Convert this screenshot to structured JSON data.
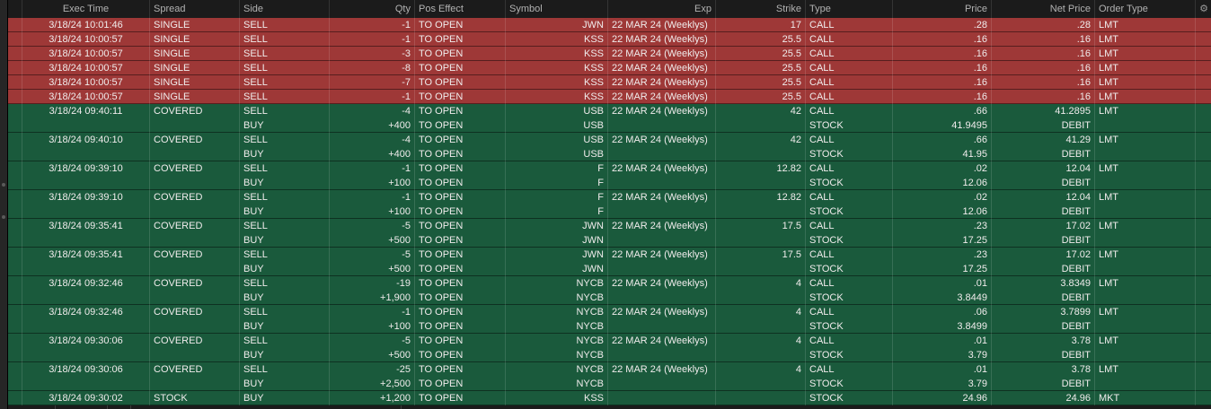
{
  "header": {
    "gear_icon": "⚙",
    "columns": [
      {
        "key": "rowmark",
        "label": ""
      },
      {
        "key": "exec_time",
        "label": "Exec Time"
      },
      {
        "key": "spread",
        "label": "Spread"
      },
      {
        "key": "side",
        "label": "Side"
      },
      {
        "key": "qty",
        "label": "Qty"
      },
      {
        "key": "pos_effect",
        "label": "Pos Effect"
      },
      {
        "key": "symbol",
        "label": "Symbol"
      },
      {
        "key": "exp",
        "label": "Exp"
      },
      {
        "key": "strike",
        "label": "Strike"
      },
      {
        "key": "type",
        "label": "Type"
      },
      {
        "key": "price",
        "label": "Price"
      },
      {
        "key": "net_price",
        "label": "Net Price"
      },
      {
        "key": "order_type",
        "label": "Order Type"
      },
      {
        "key": "gear",
        "label": ""
      }
    ]
  },
  "colors": {
    "sell_row": "#9e3837",
    "buy_covered_row": "#1a5a3c",
    "header_bg": "#1b1b1b"
  },
  "orders": [
    {
      "color": "red",
      "legs": [
        {
          "exec_time": "3/18/24 10:01:46",
          "spread": "SINGLE",
          "side": "SELL",
          "qty": "-1",
          "pos_effect": "TO OPEN",
          "symbol": "JWN",
          "exp": "22 MAR 24 (Weeklys)",
          "strike": "17",
          "type": "CALL",
          "price": ".28",
          "net_price": ".28",
          "order_type": "LMT"
        }
      ]
    },
    {
      "color": "red",
      "legs": [
        {
          "exec_time": "3/18/24 10:00:57",
          "spread": "SINGLE",
          "side": "SELL",
          "qty": "-1",
          "pos_effect": "TO OPEN",
          "symbol": "KSS",
          "exp": "22 MAR 24 (Weeklys)",
          "strike": "25.5",
          "type": "CALL",
          "price": ".16",
          "net_price": ".16",
          "order_type": "LMT"
        }
      ]
    },
    {
      "color": "red",
      "legs": [
        {
          "exec_time": "3/18/24 10:00:57",
          "spread": "SINGLE",
          "side": "SELL",
          "qty": "-3",
          "pos_effect": "TO OPEN",
          "symbol": "KSS",
          "exp": "22 MAR 24 (Weeklys)",
          "strike": "25.5",
          "type": "CALL",
          "price": ".16",
          "net_price": ".16",
          "order_type": "LMT"
        }
      ]
    },
    {
      "color": "red",
      "legs": [
        {
          "exec_time": "3/18/24 10:00:57",
          "spread": "SINGLE",
          "side": "SELL",
          "qty": "-8",
          "pos_effect": "TO OPEN",
          "symbol": "KSS",
          "exp": "22 MAR 24 (Weeklys)",
          "strike": "25.5",
          "type": "CALL",
          "price": ".16",
          "net_price": ".16",
          "order_type": "LMT"
        }
      ]
    },
    {
      "color": "red",
      "legs": [
        {
          "exec_time": "3/18/24 10:00:57",
          "spread": "SINGLE",
          "side": "SELL",
          "qty": "-7",
          "pos_effect": "TO OPEN",
          "symbol": "KSS",
          "exp": "22 MAR 24 (Weeklys)",
          "strike": "25.5",
          "type": "CALL",
          "price": ".16",
          "net_price": ".16",
          "order_type": "LMT"
        }
      ]
    },
    {
      "color": "red",
      "legs": [
        {
          "exec_time": "3/18/24 10:00:57",
          "spread": "SINGLE",
          "side": "SELL",
          "qty": "-1",
          "pos_effect": "TO OPEN",
          "symbol": "KSS",
          "exp": "22 MAR 24 (Weeklys)",
          "strike": "25.5",
          "type": "CALL",
          "price": ".16",
          "net_price": ".16",
          "order_type": "LMT"
        }
      ]
    },
    {
      "color": "green",
      "legs": [
        {
          "exec_time": "3/18/24 09:40:11",
          "spread": "COVERED",
          "side": "SELL",
          "qty": "-4",
          "pos_effect": "TO OPEN",
          "symbol": "USB",
          "exp": "22 MAR 24 (Weeklys)",
          "strike": "42",
          "type": "CALL",
          "price": ".66",
          "net_price": "41.2895",
          "order_type": "LMT"
        },
        {
          "exec_time": "",
          "spread": "",
          "side": "BUY",
          "qty": "+400",
          "pos_effect": "TO OPEN",
          "symbol": "USB",
          "exp": "",
          "strike": "",
          "type": "STOCK",
          "price": "41.9495",
          "net_price": "DEBIT",
          "order_type": ""
        }
      ]
    },
    {
      "color": "green",
      "legs": [
        {
          "exec_time": "3/18/24 09:40:10",
          "spread": "COVERED",
          "side": "SELL",
          "qty": "-4",
          "pos_effect": "TO OPEN",
          "symbol": "USB",
          "exp": "22 MAR 24 (Weeklys)",
          "strike": "42",
          "type": "CALL",
          "price": ".66",
          "net_price": "41.29",
          "order_type": "LMT"
        },
        {
          "exec_time": "",
          "spread": "",
          "side": "BUY",
          "qty": "+400",
          "pos_effect": "TO OPEN",
          "symbol": "USB",
          "exp": "",
          "strike": "",
          "type": "STOCK",
          "price": "41.95",
          "net_price": "DEBIT",
          "order_type": ""
        }
      ]
    },
    {
      "color": "green",
      "legs": [
        {
          "exec_time": "3/18/24 09:39:10",
          "spread": "COVERED",
          "side": "SELL",
          "qty": "-1",
          "pos_effect": "TO OPEN",
          "symbol": "F",
          "exp": "22 MAR 24 (Weeklys)",
          "strike": "12.82",
          "type": "CALL",
          "price": ".02",
          "net_price": "12.04",
          "order_type": "LMT"
        },
        {
          "exec_time": "",
          "spread": "",
          "side": "BUY",
          "qty": "+100",
          "pos_effect": "TO OPEN",
          "symbol": "F",
          "exp": "",
          "strike": "",
          "type": "STOCK",
          "price": "12.06",
          "net_price": "DEBIT",
          "order_type": ""
        }
      ]
    },
    {
      "color": "green",
      "legs": [
        {
          "exec_time": "3/18/24 09:39:10",
          "spread": "COVERED",
          "side": "SELL",
          "qty": "-1",
          "pos_effect": "TO OPEN",
          "symbol": "F",
          "exp": "22 MAR 24 (Weeklys)",
          "strike": "12.82",
          "type": "CALL",
          "price": ".02",
          "net_price": "12.04",
          "order_type": "LMT"
        },
        {
          "exec_time": "",
          "spread": "",
          "side": "BUY",
          "qty": "+100",
          "pos_effect": "TO OPEN",
          "symbol": "F",
          "exp": "",
          "strike": "",
          "type": "STOCK",
          "price": "12.06",
          "net_price": "DEBIT",
          "order_type": ""
        }
      ]
    },
    {
      "color": "green",
      "legs": [
        {
          "exec_time": "3/18/24 09:35:41",
          "spread": "COVERED",
          "side": "SELL",
          "qty": "-5",
          "pos_effect": "TO OPEN",
          "symbol": "JWN",
          "exp": "22 MAR 24 (Weeklys)",
          "strike": "17.5",
          "type": "CALL",
          "price": ".23",
          "net_price": "17.02",
          "order_type": "LMT"
        },
        {
          "exec_time": "",
          "spread": "",
          "side": "BUY",
          "qty": "+500",
          "pos_effect": "TO OPEN",
          "symbol": "JWN",
          "exp": "",
          "strike": "",
          "type": "STOCK",
          "price": "17.25",
          "net_price": "DEBIT",
          "order_type": ""
        }
      ]
    },
    {
      "color": "green",
      "legs": [
        {
          "exec_time": "3/18/24 09:35:41",
          "spread": "COVERED",
          "side": "SELL",
          "qty": "-5",
          "pos_effect": "TO OPEN",
          "symbol": "JWN",
          "exp": "22 MAR 24 (Weeklys)",
          "strike": "17.5",
          "type": "CALL",
          "price": ".23",
          "net_price": "17.02",
          "order_type": "LMT"
        },
        {
          "exec_time": "",
          "spread": "",
          "side": "BUY",
          "qty": "+500",
          "pos_effect": "TO OPEN",
          "symbol": "JWN",
          "exp": "",
          "strike": "",
          "type": "STOCK",
          "price": "17.25",
          "net_price": "DEBIT",
          "order_type": ""
        }
      ]
    },
    {
      "color": "green",
      "legs": [
        {
          "exec_time": "3/18/24 09:32:46",
          "spread": "COVERED",
          "side": "SELL",
          "qty": "-19",
          "pos_effect": "TO OPEN",
          "symbol": "NYCB",
          "exp": "22 MAR 24 (Weeklys)",
          "strike": "4",
          "type": "CALL",
          "price": ".01",
          "net_price": "3.8349",
          "order_type": "LMT"
        },
        {
          "exec_time": "",
          "spread": "",
          "side": "BUY",
          "qty": "+1,900",
          "pos_effect": "TO OPEN",
          "symbol": "NYCB",
          "exp": "",
          "strike": "",
          "type": "STOCK",
          "price": "3.8449",
          "net_price": "DEBIT",
          "order_type": ""
        }
      ]
    },
    {
      "color": "green",
      "legs": [
        {
          "exec_time": "3/18/24 09:32:46",
          "spread": "COVERED",
          "side": "SELL",
          "qty": "-1",
          "pos_effect": "TO OPEN",
          "symbol": "NYCB",
          "exp": "22 MAR 24 (Weeklys)",
          "strike": "4",
          "type": "CALL",
          "price": ".06",
          "net_price": "3.7899",
          "order_type": "LMT"
        },
        {
          "exec_time": "",
          "spread": "",
          "side": "BUY",
          "qty": "+100",
          "pos_effect": "TO OPEN",
          "symbol": "NYCB",
          "exp": "",
          "strike": "",
          "type": "STOCK",
          "price": "3.8499",
          "net_price": "DEBIT",
          "order_type": ""
        }
      ]
    },
    {
      "color": "green",
      "legs": [
        {
          "exec_time": "3/18/24 09:30:06",
          "spread": "COVERED",
          "side": "SELL",
          "qty": "-5",
          "pos_effect": "TO OPEN",
          "symbol": "NYCB",
          "exp": "22 MAR 24 (Weeklys)",
          "strike": "4",
          "type": "CALL",
          "price": ".01",
          "net_price": "3.78",
          "order_type": "LMT"
        },
        {
          "exec_time": "",
          "spread": "",
          "side": "BUY",
          "qty": "+500",
          "pos_effect": "TO OPEN",
          "symbol": "NYCB",
          "exp": "",
          "strike": "",
          "type": "STOCK",
          "price": "3.79",
          "net_price": "DEBIT",
          "order_type": ""
        }
      ]
    },
    {
      "color": "green",
      "legs": [
        {
          "exec_time": "3/18/24 09:30:06",
          "spread": "COVERED",
          "side": "SELL",
          "qty": "-25",
          "pos_effect": "TO OPEN",
          "symbol": "NYCB",
          "exp": "22 MAR 24 (Weeklys)",
          "strike": "4",
          "type": "CALL",
          "price": ".01",
          "net_price": "3.78",
          "order_type": "LMT"
        },
        {
          "exec_time": "",
          "spread": "",
          "side": "BUY",
          "qty": "+2,500",
          "pos_effect": "TO OPEN",
          "symbol": "NYCB",
          "exp": "",
          "strike": "",
          "type": "STOCK",
          "price": "3.79",
          "net_price": "DEBIT",
          "order_type": ""
        }
      ]
    },
    {
      "color": "green",
      "legs": [
        {
          "exec_time": "3/18/24 09:30:02",
          "spread": "STOCK",
          "side": "BUY",
          "qty": "+1,200",
          "pos_effect": "TO OPEN",
          "symbol": "KSS",
          "exp": "",
          "strike": "",
          "type": "STOCK",
          "price": "24.96",
          "net_price": "24.96",
          "order_type": "MKT"
        }
      ]
    }
  ]
}
